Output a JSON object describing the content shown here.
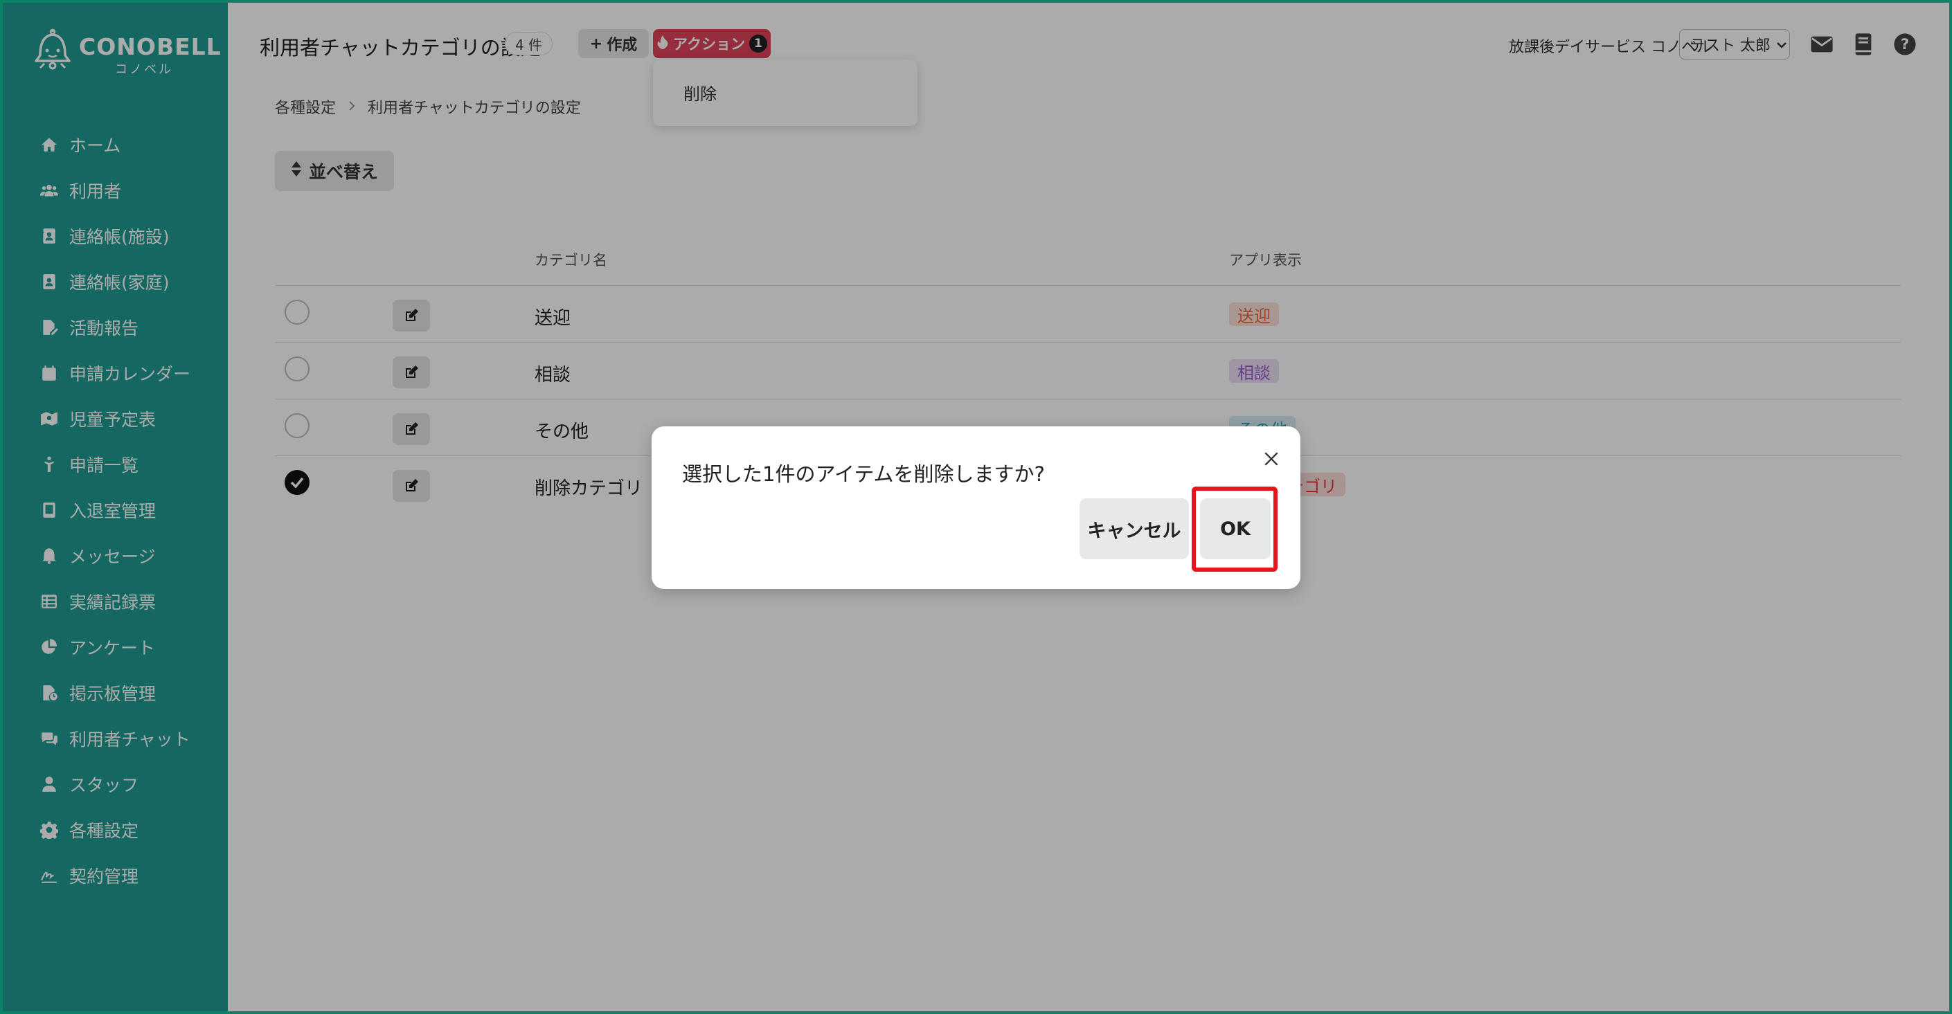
{
  "brand": {
    "name": "CONOBELL",
    "sub": "コノベル"
  },
  "sidebar": {
    "items": [
      {
        "label": "ホーム",
        "icon": "home-icon"
      },
      {
        "label": "利用者",
        "icon": "users-icon"
      },
      {
        "label": "連絡帳(施設)",
        "icon": "contact-book-icon"
      },
      {
        "label": "連絡帳(家庭)",
        "icon": "contact-book-icon"
      },
      {
        "label": "活動報告",
        "icon": "file-edit-icon"
      },
      {
        "label": "申請カレンダー",
        "icon": "calendar-icon"
      },
      {
        "label": "児童予定表",
        "icon": "map-icon"
      },
      {
        "label": "申請一覧",
        "icon": "child-icon"
      },
      {
        "label": "入退室管理",
        "icon": "tablet-icon"
      },
      {
        "label": "メッセージ",
        "icon": "bell-icon"
      },
      {
        "label": "実績記録票",
        "icon": "table-icon"
      },
      {
        "label": "アンケート",
        "icon": "pie-chart-icon"
      },
      {
        "label": "掲示板管理",
        "icon": "file-clock-icon"
      },
      {
        "label": "利用者チャット",
        "icon": "chat-icon"
      },
      {
        "label": "スタッフ",
        "icon": "staff-icon"
      },
      {
        "label": "各種設定",
        "icon": "gear-icon"
      },
      {
        "label": "契約管理",
        "icon": "signature-icon"
      }
    ]
  },
  "header": {
    "title": "利用者チャットカテゴリの設定",
    "count": "4 件",
    "create_label": "作成",
    "action_label": "アクション",
    "action_count": "1",
    "facility": "放課後デイサービス コノベル",
    "user": "テスト 太郎"
  },
  "dropdown": {
    "items": [
      "削除"
    ]
  },
  "breadcrumb": {
    "items": [
      "各種設定",
      "利用者チャットカテゴリの設定"
    ]
  },
  "sort_label": "並べ替え",
  "table": {
    "headers": {
      "name": "カテゴリ名",
      "app": "アプリ表示"
    },
    "rows": [
      {
        "name": "送迎",
        "tag": "送迎",
        "tag_color": "#f0643c",
        "tag_bg": "#fde3da",
        "checked": false
      },
      {
        "name": "相談",
        "tag": "相談",
        "tag_color": "#9a5bd0",
        "tag_bg": "#ecdff7",
        "checked": false
      },
      {
        "name": "その他",
        "tag": "その他",
        "tag_color": "#2a9fc4",
        "tag_bg": "#d9eff7",
        "checked": false
      },
      {
        "name": "削除カテゴリ",
        "tag": "削除カテゴリ",
        "tag_color": "#e23b3b",
        "tag_bg": "#fbdcdc",
        "checked": true
      }
    ]
  },
  "modal": {
    "message": "選択した1件のアイテムを削除しますか?",
    "cancel_label": "キャンセル",
    "ok_label": "OK"
  },
  "colors": {
    "sidebar": "#1f9c91",
    "accent": "#e0435a",
    "highlight": "#e8141b"
  }
}
